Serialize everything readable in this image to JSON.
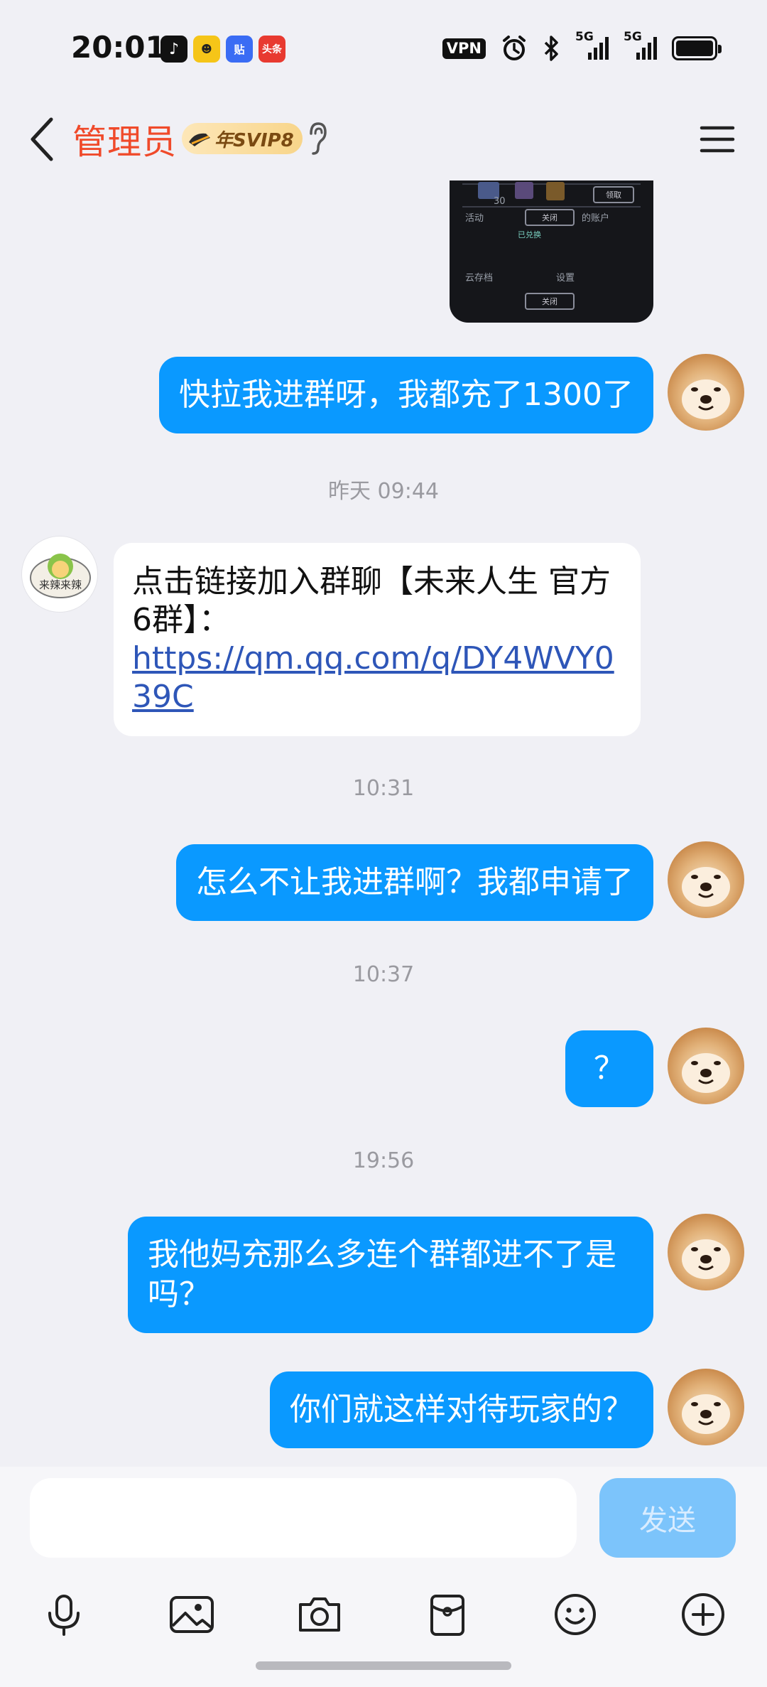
{
  "status_bar": {
    "time": "20:01",
    "app_icons": [
      "tiktok-icon",
      "app-icon-yellow",
      "tieba-icon",
      "toutiao-icon"
    ],
    "app_icon_labels": [
      "贴",
      "头条"
    ],
    "vpn": "VPN",
    "network": [
      "5G",
      "5G"
    ]
  },
  "header": {
    "title": "管理员",
    "badge": "年SVIP8"
  },
  "chat": {
    "image_preview_labels": [
      "活动",
      "关闭",
      "的账户",
      "已兑换",
      "云存档",
      "设置",
      "关闭",
      "领取",
      "30"
    ],
    "messages": [
      {
        "type": "timestamp",
        "text": "昨天 09:44"
      },
      {
        "type": "timestamp",
        "text": "10:31"
      },
      {
        "type": "timestamp",
        "text": "10:37"
      },
      {
        "type": "timestamp",
        "text": "19:56"
      }
    ],
    "out_1": "快拉我进群呀，我都充了1300了",
    "in_1_text": "点击链接加入群聊【未来人生 官方6群】：",
    "in_1_link": "https://qm.qq.com/q/DY4WVY039C",
    "admin_avatar_text": "来辣来辣",
    "out_2": "怎么不让我进群啊？我都申请了",
    "out_3": "？",
    "out_4": "我他妈充那么多连个群都进不了是吗？",
    "out_5": "你们就这样对待玩家的？"
  },
  "input": {
    "placeholder": "",
    "send_label": "发送"
  },
  "colors": {
    "accent": "#0a99ff",
    "title": "#f04a2a",
    "send_disabled": "#7cc4fb",
    "background": "#f0f0f5"
  }
}
